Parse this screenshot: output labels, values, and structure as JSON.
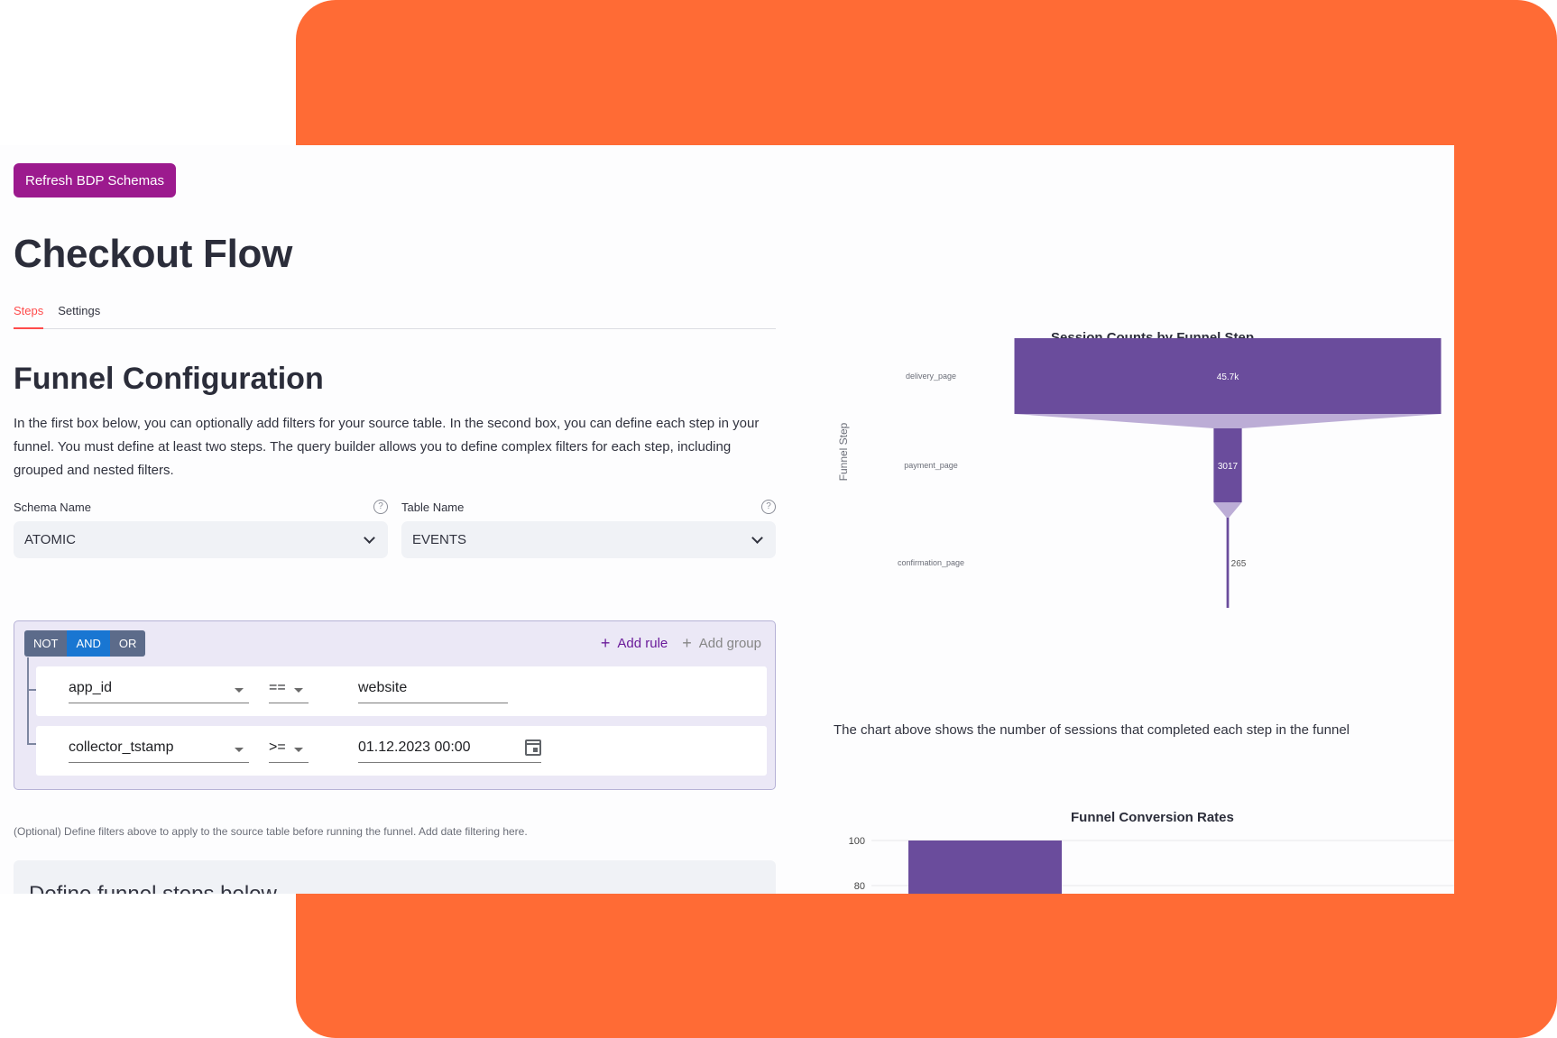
{
  "toolbar": {
    "refresh_label": "Refresh BDP Schemas"
  },
  "page": {
    "title": "Checkout Flow"
  },
  "tabs": [
    {
      "label": "Steps"
    },
    {
      "label": "Settings"
    }
  ],
  "funnel_config": {
    "title": "Funnel Configuration",
    "intro": "In the first box below, you can optionally add filters for your source table. In the second box, you can define each step in your funnel. You must define at least two steps. The query builder allows you to define complex filters for each step, including grouped and nested filters.",
    "schema": {
      "label": "Schema Name",
      "value": "ATOMIC",
      "help": "?"
    },
    "table": {
      "label": "Table Name",
      "value": "EVENTS",
      "help": "?"
    }
  },
  "query_builder": {
    "combinators": [
      "NOT",
      "AND",
      "OR"
    ],
    "active_combinator": "AND",
    "add_rule": "Add rule",
    "add_group": "Add group",
    "rules": [
      {
        "field": "app_id",
        "operator": "==",
        "value": "website"
      },
      {
        "field": "collector_tstamp",
        "operator": ">=",
        "value": "01.12.2023 00:00"
      }
    ]
  },
  "filter_caption": "(Optional) Define filters above to apply to the source table before running the funnel. Add date filtering here.",
  "steps_box": {
    "title": "Define funnel steps below"
  },
  "chart_caption": "The chart above shows the number of sessions that completed each step in the funnel",
  "chart_data": [
    {
      "type": "bar",
      "title": "Session Counts by Funnel Step",
      "ylabel": "Funnel Step",
      "categories": [
        "delivery_page",
        "payment_page",
        "confirmation_page"
      ],
      "values": [
        45700,
        3017,
        265
      ],
      "value_labels": [
        "45.7k",
        "3017",
        "265"
      ],
      "orientation": "horizontal-funnel",
      "color": "#6a4c9c",
      "connector_color": "#bcadd6"
    },
    {
      "type": "bar",
      "title": "Funnel Conversion Rates",
      "y_ticks": [
        "100",
        "80"
      ],
      "ylim": [
        0,
        100
      ],
      "values": [
        100
      ],
      "color": "#6a4c9c"
    }
  ]
}
